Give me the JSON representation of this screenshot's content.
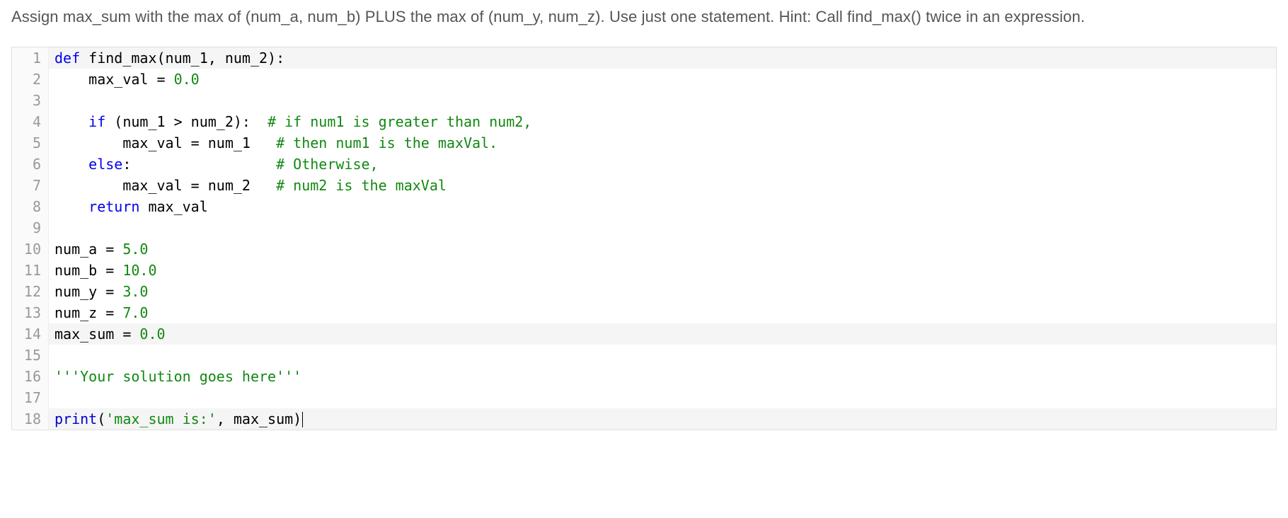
{
  "instructions": "Assign max_sum with the max of (num_a, num_b) PLUS the max of (num_y, num_z). Use just one statement. Hint: Call find_max() twice in an expression.",
  "code": {
    "lines": [
      {
        "num": "1",
        "highlighted": true,
        "segments": [
          {
            "cls": "kw",
            "text": "def"
          },
          {
            "cls": "plain",
            "text": " find_max(num_1, num_2):"
          }
        ]
      },
      {
        "num": "2",
        "segments": [
          {
            "cls": "plain",
            "text": "    max_val = "
          },
          {
            "cls": "num",
            "text": "0.0"
          }
        ]
      },
      {
        "num": "3",
        "segments": []
      },
      {
        "num": "4",
        "segments": [
          {
            "cls": "plain",
            "text": "    "
          },
          {
            "cls": "kw",
            "text": "if"
          },
          {
            "cls": "plain",
            "text": " (num_1 > num_2):  "
          },
          {
            "cls": "comment",
            "text": "# if num1 is greater than num2,"
          }
        ]
      },
      {
        "num": "5",
        "segments": [
          {
            "cls": "plain",
            "text": "        max_val = num_1   "
          },
          {
            "cls": "comment",
            "text": "# then num1 is the maxVal."
          }
        ]
      },
      {
        "num": "6",
        "segments": [
          {
            "cls": "plain",
            "text": "    "
          },
          {
            "cls": "kw",
            "text": "else"
          },
          {
            "cls": "plain",
            "text": ":                 "
          },
          {
            "cls": "comment",
            "text": "# Otherwise,"
          }
        ]
      },
      {
        "num": "7",
        "segments": [
          {
            "cls": "plain",
            "text": "        max_val = num_2   "
          },
          {
            "cls": "comment",
            "text": "# num2 is the maxVal"
          }
        ]
      },
      {
        "num": "8",
        "segments": [
          {
            "cls": "plain",
            "text": "    "
          },
          {
            "cls": "kw",
            "text": "return"
          },
          {
            "cls": "plain",
            "text": " max_val"
          }
        ]
      },
      {
        "num": "9",
        "segments": []
      },
      {
        "num": "10",
        "segments": [
          {
            "cls": "plain",
            "text": "num_a = "
          },
          {
            "cls": "num",
            "text": "5.0"
          }
        ]
      },
      {
        "num": "11",
        "segments": [
          {
            "cls": "plain",
            "text": "num_b = "
          },
          {
            "cls": "num",
            "text": "10.0"
          }
        ]
      },
      {
        "num": "12",
        "segments": [
          {
            "cls": "plain",
            "text": "num_y = "
          },
          {
            "cls": "num",
            "text": "3.0"
          }
        ]
      },
      {
        "num": "13",
        "segments": [
          {
            "cls": "plain",
            "text": "num_z = "
          },
          {
            "cls": "num",
            "text": "7.0"
          }
        ]
      },
      {
        "num": "14",
        "highlighted": true,
        "segments": [
          {
            "cls": "plain",
            "text": "max_sum = "
          },
          {
            "cls": "num",
            "text": "0.0"
          }
        ]
      },
      {
        "num": "15",
        "segments": []
      },
      {
        "num": "16",
        "segments": [
          {
            "cls": "str",
            "text": "'''Your solution goes here'''"
          }
        ]
      },
      {
        "num": "17",
        "segments": []
      },
      {
        "num": "18",
        "highlighted": true,
        "cursor": true,
        "segments": [
          {
            "cls": "builtin",
            "text": "print"
          },
          {
            "cls": "plain",
            "text": "("
          },
          {
            "cls": "str",
            "text": "'max_sum is:'"
          },
          {
            "cls": "plain",
            "text": ", max_sum)"
          }
        ]
      }
    ]
  }
}
